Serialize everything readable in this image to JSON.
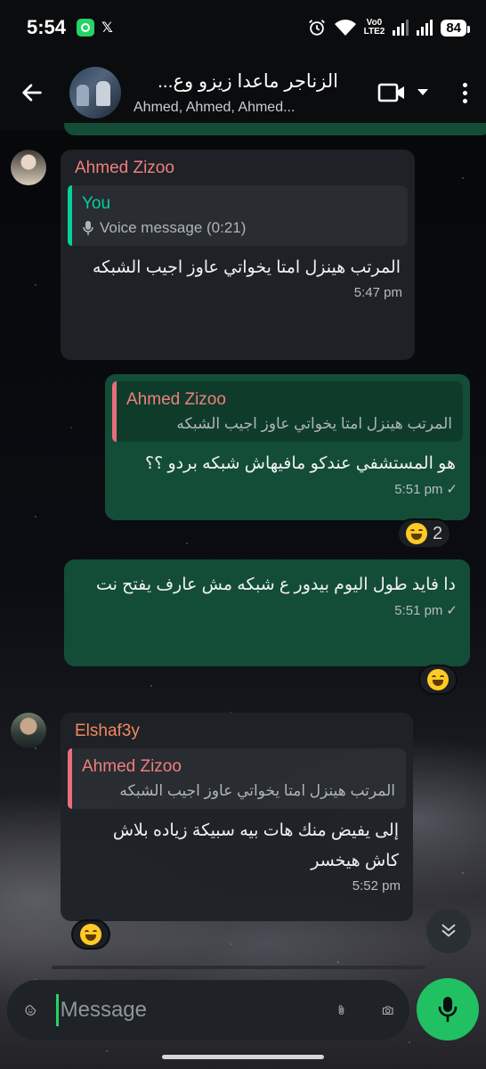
{
  "status_bar": {
    "time": "5:54",
    "network_label_1": "Vo0",
    "network_label_2": "LTE2",
    "battery": "84"
  },
  "header": {
    "title": "الزناجر ماعدا زيزو وع...",
    "subtitle": "Ahmed, Ahmed, Ahmed..."
  },
  "messages": [
    {
      "sender": "Ahmed Zizoo",
      "sender_color": "#f07f7f",
      "quote_name": "You",
      "quote_text": "Voice message (0:21)",
      "text": "المرتب هينزل امتا يخواتي عاوز اجيب الشبكه",
      "time": "5:47 pm"
    },
    {
      "quote_name": "Ahmed Zizoo",
      "quote_text": "المرتب هينزل امتا يخواتي عاوز اجيب الشبكه",
      "text": "هو المستشفي عندكو مافيهاش شبكه بردو ؟؟",
      "time": "5:51 pm",
      "reaction_count": "2"
    },
    {
      "text": "دا فايد طول اليوم بيدور ع شبكه مش عارف يفتح نت",
      "time": "5:51 pm"
    },
    {
      "sender": "Elshaf3y",
      "sender_color": "#f0895f",
      "quote_name": "Ahmed Zizoo",
      "quote_text": "المرتب هينزل امتا يخواتي عاوز اجيب الشبكه",
      "text": "إلى يفيض منك هات بيه سبيكة زياده بلاش كاش هيخسر",
      "time": "5:52 pm"
    }
  ],
  "composer": {
    "placeholder": "Message"
  },
  "colors": {
    "accent": "#25d366",
    "outgoing_bubble": "#144d37",
    "incoming_bubble": "#1f2226",
    "quote_green": "#06cf9c",
    "quote_pink": "#e86e7d"
  }
}
